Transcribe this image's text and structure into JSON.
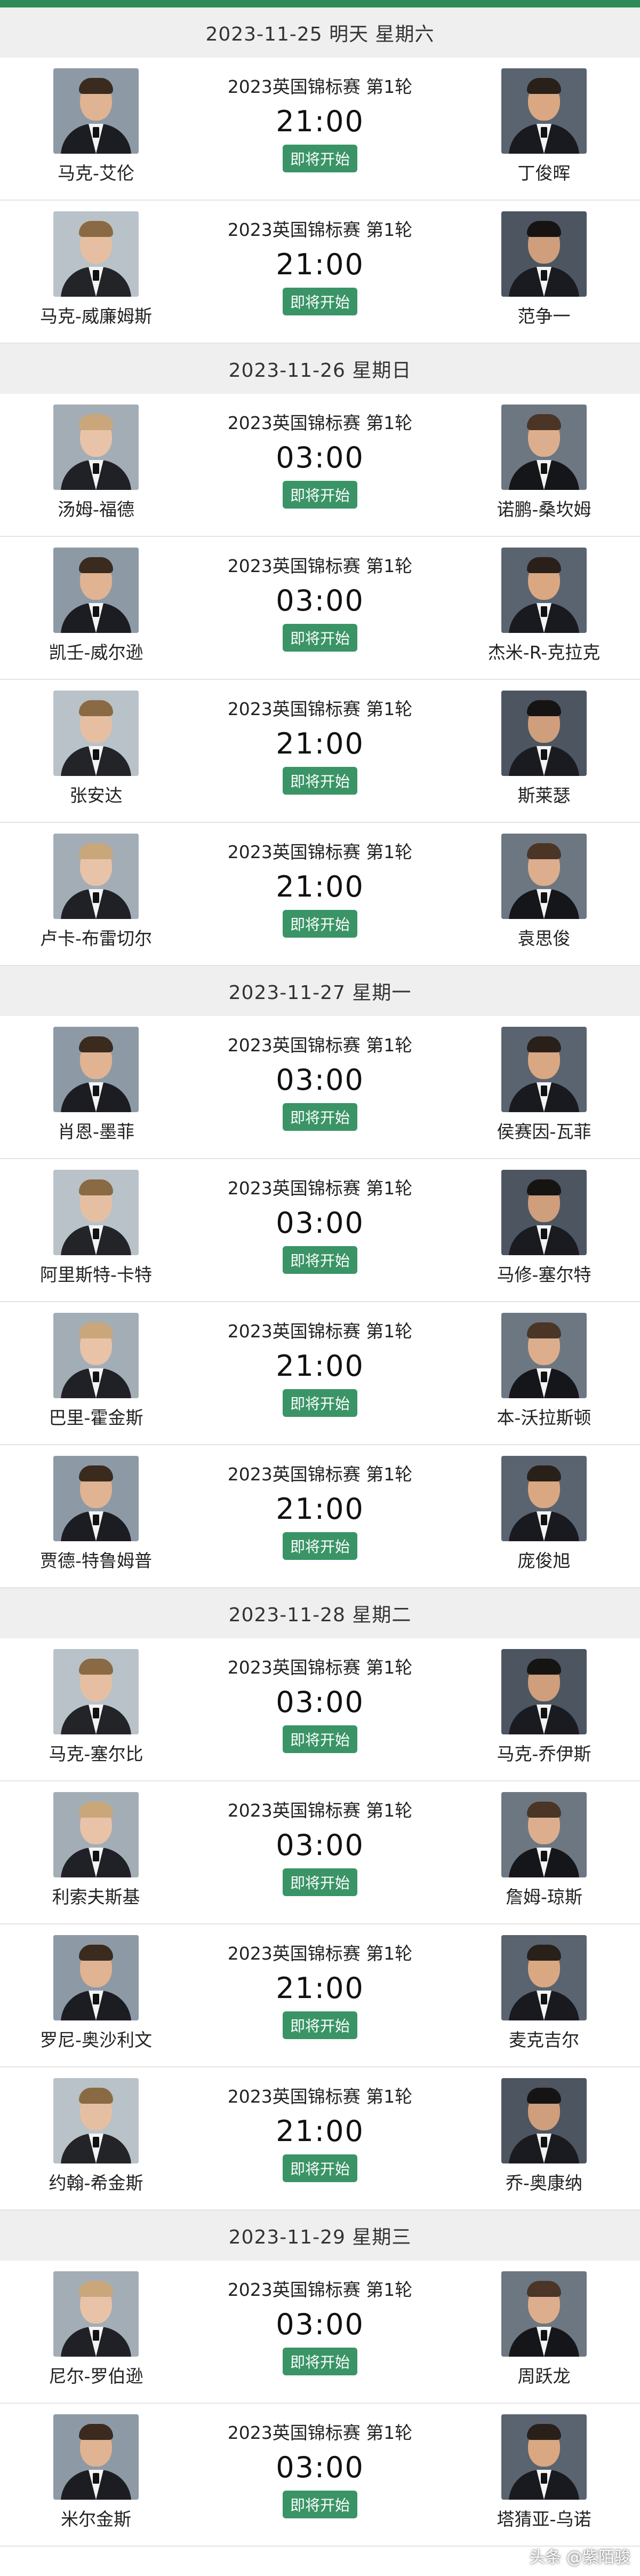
{
  "status_label": "即将开始",
  "watermark": "头条 @紫陌骏",
  "days": [
    {
      "date": "2023-11-25 明天 星期六",
      "matches": [
        {
          "event": "2023英国锦标赛 第1轮",
          "time": "21:00",
          "left": "马克-艾伦",
          "right": "丁俊晖"
        },
        {
          "event": "2023英国锦标赛 第1轮",
          "time": "21:00",
          "left": "马克-威廉姆斯",
          "right": "范争一"
        }
      ]
    },
    {
      "date": "2023-11-26 星期日",
      "matches": [
        {
          "event": "2023英国锦标赛 第1轮",
          "time": "03:00",
          "left": "汤姆-福德",
          "right": "诺鹏-桑坎姆"
        },
        {
          "event": "2023英国锦标赛 第1轮",
          "time": "03:00",
          "left": "凯壬-威尔逊",
          "right": "杰米-R-克拉克"
        },
        {
          "event": "2023英国锦标赛 第1轮",
          "time": "21:00",
          "left": "张安达",
          "right": "斯莱瑟"
        },
        {
          "event": "2023英国锦标赛 第1轮",
          "time": "21:00",
          "left": "卢卡-布雷切尔",
          "right": "袁思俊"
        }
      ]
    },
    {
      "date": "2023-11-27 星期一",
      "matches": [
        {
          "event": "2023英国锦标赛 第1轮",
          "time": "03:00",
          "left": "肖恩-墨菲",
          "right": "侯赛因-瓦菲"
        },
        {
          "event": "2023英国锦标赛 第1轮",
          "time": "03:00",
          "left": "阿里斯特-卡特",
          "right": "马修-塞尔特"
        },
        {
          "event": "2023英国锦标赛 第1轮",
          "time": "21:00",
          "left": "巴里-霍金斯",
          "right": "本-沃拉斯顿"
        },
        {
          "event": "2023英国锦标赛 第1轮",
          "time": "21:00",
          "left": "贾德-特鲁姆普",
          "right": "庞俊旭"
        }
      ]
    },
    {
      "date": "2023-11-28 星期二",
      "matches": [
        {
          "event": "2023英国锦标赛 第1轮",
          "time": "03:00",
          "left": "马克-塞尔比",
          "right": "马克-乔伊斯"
        },
        {
          "event": "2023英国锦标赛 第1轮",
          "time": "03:00",
          "left": "利索夫斯基",
          "right": "詹姆-琼斯"
        },
        {
          "event": "2023英国锦标赛 第1轮",
          "time": "21:00",
          "left": "罗尼-奥沙利文",
          "right": "麦克吉尔"
        },
        {
          "event": "2023英国锦标赛 第1轮",
          "time": "21:00",
          "left": "约翰-希金斯",
          "right": "乔-奥康纳"
        }
      ]
    },
    {
      "date": "2023-11-29 星期三",
      "matches": [
        {
          "event": "2023英国锦标赛 第1轮",
          "time": "03:00",
          "left": "尼尔-罗伯逊",
          "right": "周跃龙"
        },
        {
          "event": "2023英国锦标赛 第1轮",
          "time": "03:00",
          "left": "米尔金斯",
          "right": "塔猜亚-乌诺"
        }
      ]
    }
  ]
}
